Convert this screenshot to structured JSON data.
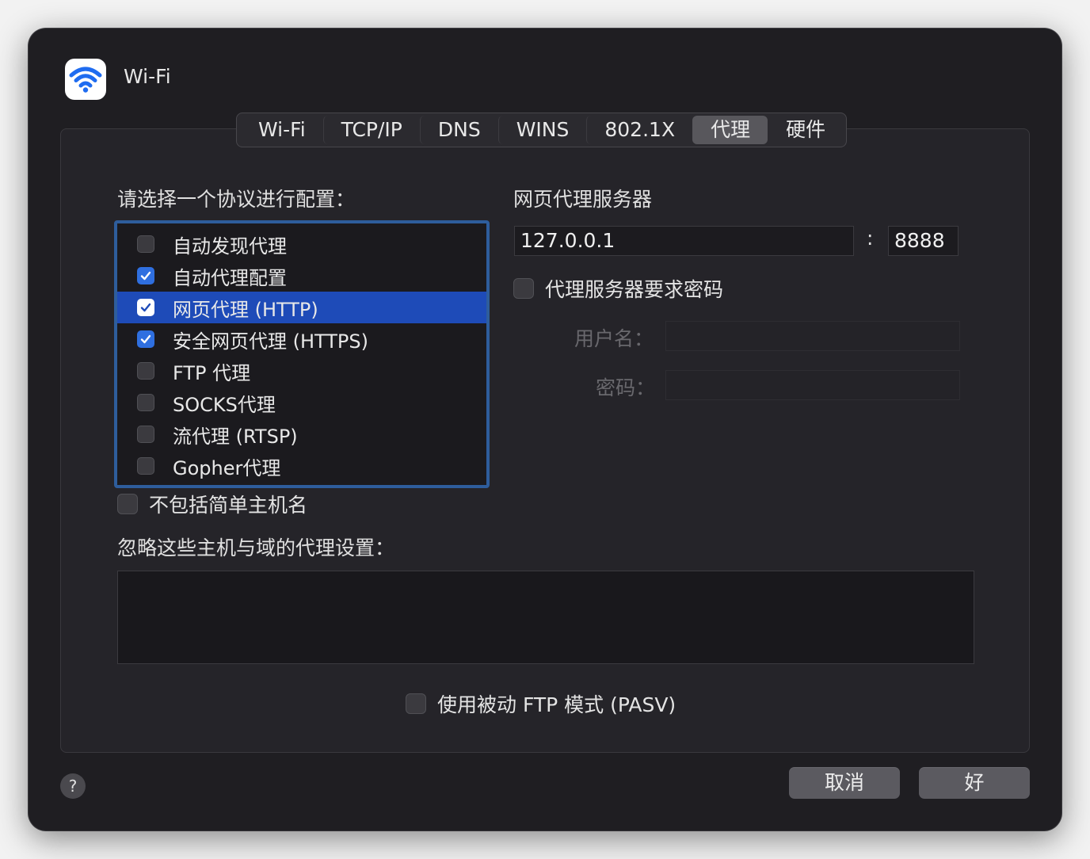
{
  "window": {
    "title": "Wi-Fi"
  },
  "tabs": [
    {
      "label": "Wi-Fi",
      "active": false
    },
    {
      "label": "TCP/IP",
      "active": false
    },
    {
      "label": "DNS",
      "active": false
    },
    {
      "label": "WINS",
      "active": false
    },
    {
      "label": "802.1X",
      "active": false
    },
    {
      "label": "代理",
      "active": true
    },
    {
      "label": "硬件",
      "active": false
    }
  ],
  "protocols": {
    "heading": "请选择一个协议进行配置：",
    "items": [
      {
        "label": "自动发现代理",
        "checked": false,
        "selected": false
      },
      {
        "label": "自动代理配置",
        "checked": true,
        "selected": false
      },
      {
        "label": "网页代理 (HTTP)",
        "checked": true,
        "selected": true
      },
      {
        "label": "安全网页代理 (HTTPS)",
        "checked": true,
        "selected": false
      },
      {
        "label": "FTP 代理",
        "checked": false,
        "selected": false
      },
      {
        "label": "SOCKS代理",
        "checked": false,
        "selected": false
      },
      {
        "label": "流代理 (RTSP)",
        "checked": false,
        "selected": false
      },
      {
        "label": "Gopher代理",
        "checked": false,
        "selected": false
      }
    ]
  },
  "server": {
    "heading": "网页代理服务器",
    "host": "127.0.0.1",
    "separator": ":",
    "port": "8888",
    "require_password_label": "代理服务器要求密码",
    "require_password_checked": false,
    "username_label": "用户名：",
    "username_value": "",
    "password_label": "密码：",
    "password_value": ""
  },
  "exclude_simple": {
    "label": "不包括简单主机名",
    "checked": false
  },
  "bypass": {
    "label": "忽略这些主机与域的代理设置：",
    "value": ""
  },
  "pasv": {
    "label": "使用被动 FTP 模式 (PASV)",
    "checked": false
  },
  "footer": {
    "help": "?",
    "cancel": "取消",
    "ok": "好"
  },
  "colors": {
    "accent": "#2f6fe0",
    "selection": "#1e4bb8",
    "focus_ring": "#2e5d9c"
  }
}
